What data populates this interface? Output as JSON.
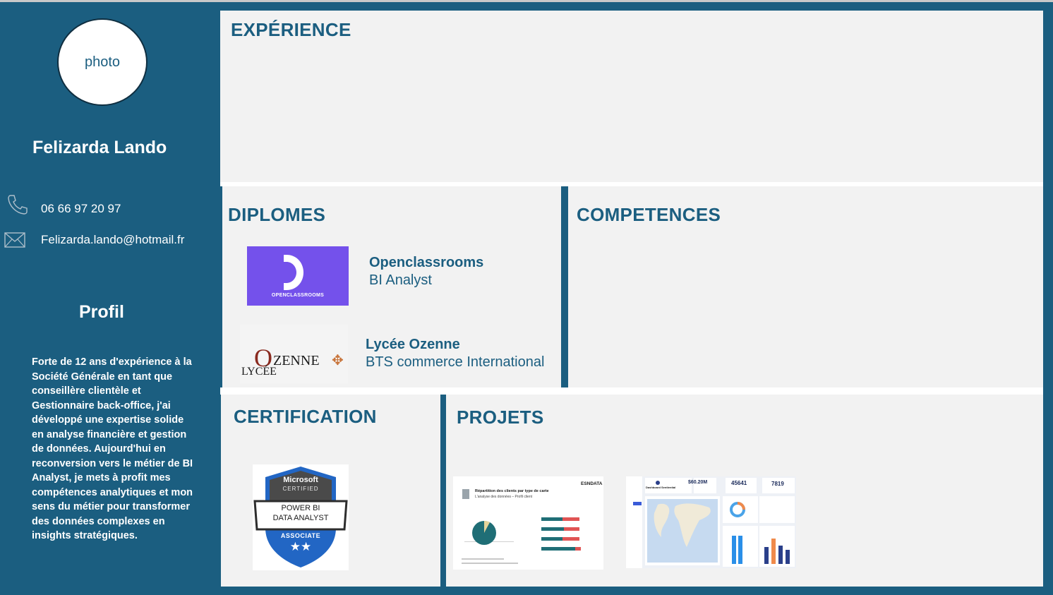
{
  "sidebar": {
    "photo_label": "photo",
    "name": "Felizarda Lando",
    "phone": "06 66 97 20 97",
    "email": "Felizarda.lando@hotmail.fr",
    "phone_icon": "phone-icon",
    "email_icon": "envelope-icon",
    "profil_title": "Profil",
    "profil_text": "Forte de 12 ans d'expérience à la Société Générale en tant que  conseillère clientèle et Gestionnaire back-office, j'ai développé une expertise solide en analyse financière et gestion de données. Aujourd'hui en reconversion vers le métier de BI Analyst, je mets à profit mes compétences analytiques et mon sens du métier pour transformer des données complexes en insights stratégiques."
  },
  "experience": {
    "title": "EXPÉRIENCE"
  },
  "diplomes": {
    "title": "DIPLOMES",
    "items": [
      {
        "school": "Openclassrooms",
        "degree": "BI Analyst",
        "logo_text": "OPENCLASSROOMS"
      },
      {
        "school": "Lycée Ozenne",
        "degree": "BTS commerce International",
        "logo_text_1": "LYCÉE",
        "logo_text_2": "ZENNE",
        "logo_letter": "O"
      }
    ]
  },
  "competences": {
    "title": "COMPETENCES"
  },
  "certification": {
    "title": "CERTIFICATION",
    "badge": {
      "brand": "Microsoft",
      "certified": "CERTIFIED",
      "line1": "POWER BI",
      "line2": "DATA ANALYST",
      "level": "ASSOCIATE",
      "stars": "★★"
    }
  },
  "projets": {
    "title": "PROJETS",
    "thumb1": {
      "title": "Répartition des clients par type de carte",
      "subtitle": "L'analyse des données – Profil client",
      "brand": "ESNDATA"
    },
    "thumb2": {
      "title": "Dashboard Sentiential",
      "kpi1": "$60.20M",
      "kpi2": "45641",
      "kpi3": "7819"
    }
  },
  "colors": {
    "primary": "#1b5e80",
    "panel": "#f2f2f2",
    "openclassrooms": "#7451eb"
  }
}
